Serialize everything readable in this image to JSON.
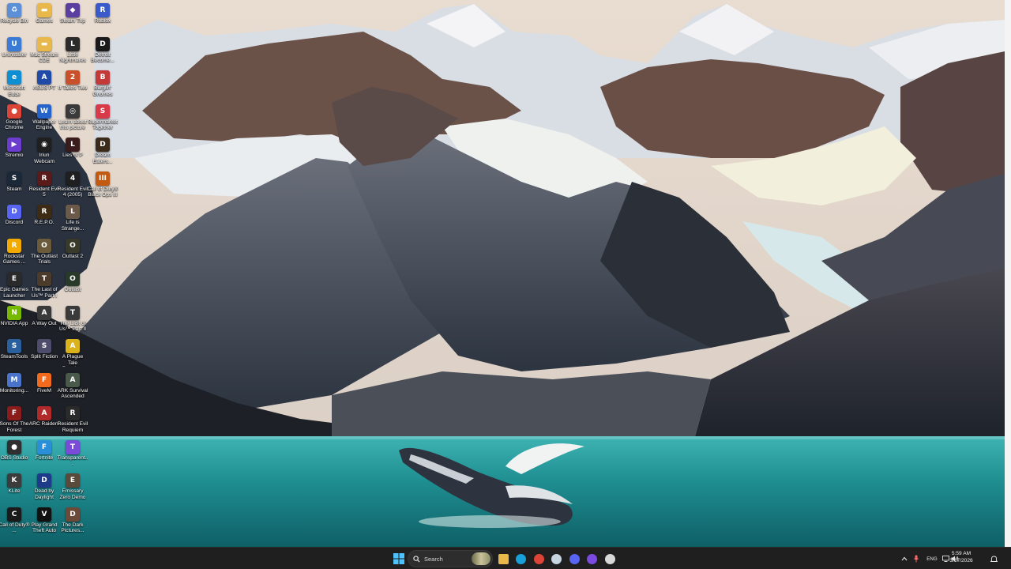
{
  "desktop": {
    "icons": [
      {
        "label": "Recycle Bin",
        "icon": "recycle-bin-icon",
        "color": "#5b8fd8",
        "glyph": "♻"
      },
      {
        "label": "Uninstaller",
        "icon": "uninstaller-icon",
        "color": "#3a7bd5",
        "glyph": "U"
      },
      {
        "label": "Microsoft Edge",
        "icon": "edge-icon",
        "color": "#0f8fd1",
        "glyph": "e"
      },
      {
        "label": "Google Chrome",
        "icon": "chrome-icon",
        "color": "#db4437",
        "glyph": "●"
      },
      {
        "label": "Stremio",
        "icon": "stremio-icon",
        "color": "#6c3ccf",
        "glyph": "▶"
      },
      {
        "label": "Steam",
        "icon": "steam-icon",
        "color": "#1b2838",
        "glyph": "S"
      },
      {
        "label": "Discord",
        "icon": "discord-icon",
        "color": "#5865f2",
        "glyph": "D"
      },
      {
        "label": "Rockstar Games ...",
        "icon": "rockstar-icon",
        "color": "#f2a900",
        "glyph": "R"
      },
      {
        "label": "Epic Games Launcher",
        "icon": "epic-games-icon",
        "color": "#2a2a2a",
        "glyph": "E"
      },
      {
        "label": "NVIDIA App",
        "icon": "nvidia-icon",
        "color": "#76b900",
        "glyph": "N"
      },
      {
        "label": "SteamTools",
        "icon": "steamtools-icon",
        "color": "#2a5f9e",
        "glyph": "S"
      },
      {
        "label": "Monitoring...",
        "icon": "monitoring-icon",
        "color": "#4a74c9",
        "glyph": "M"
      },
      {
        "label": "Sons Of The Forest",
        "icon": "sons-forest-icon",
        "color": "#8a1c1c",
        "glyph": "F"
      },
      {
        "label": "OBS Studio",
        "icon": "obs-icon",
        "color": "#302e31",
        "glyph": "●"
      },
      {
        "label": "KLite",
        "icon": "klite-icon",
        "color": "#3c3c3c",
        "glyph": "K"
      },
      {
        "label": "Call of Duty® ...",
        "icon": "cod-icon",
        "color": "#1a1a1a",
        "glyph": "C"
      },
      {
        "label": "Games",
        "icon": "folder-icon",
        "color": "#e8b94a",
        "glyph": "▬"
      },
      {
        "label": "Mac Stream CDE",
        "icon": "folder-icon-2",
        "color": "#e8b94a",
        "glyph": "▬"
      },
      {
        "label": "ASUS PT",
        "icon": "asus-icon",
        "color": "#1f4aa8",
        "glyph": "A"
      },
      {
        "label": "Wallpaper Engine",
        "icon": "wallpaper-engine-icon",
        "color": "#2463c9",
        "glyph": "W"
      },
      {
        "label": "Iriun Webcam",
        "icon": "webcam-icon",
        "color": "#1f1f1f",
        "glyph": "◉"
      },
      {
        "label": "Resident Evil 5",
        "icon": "re5-icon",
        "color": "#5a1a1a",
        "glyph": "R"
      },
      {
        "label": "R.E.P.O.",
        "icon": "repo-icon",
        "color": "#3d2b14",
        "glyph": "R"
      },
      {
        "label": "The Outlast Trials",
        "icon": "outlast-trials-icon",
        "color": "#6b5b3a",
        "glyph": "O"
      },
      {
        "label": "The Last of Us™ Part I",
        "icon": "tlou-icon",
        "color": "#4a3b2a",
        "glyph": "T"
      },
      {
        "label": "A Way Out",
        "icon": "a-way-out-icon",
        "color": "#3a3a3a",
        "glyph": "A"
      },
      {
        "label": "Split Fiction",
        "icon": "split-fiction-icon",
        "color": "#4d4d6b",
        "glyph": "S"
      },
      {
        "label": "FiveM",
        "icon": "fivem-icon",
        "color": "#f26b1d",
        "glyph": "F"
      },
      {
        "label": "ARC Raiders",
        "icon": "arc-raiders-icon",
        "color": "#b02a2a",
        "glyph": "A"
      },
      {
        "label": "Fortnite",
        "icon": "fortnite-icon",
        "color": "#2a8fd8",
        "glyph": "F"
      },
      {
        "label": "Dead by Daylight",
        "icon": "dbd-icon",
        "color": "#1e3a8a",
        "glyph": "D"
      },
      {
        "label": "Play Grand Theft Auto",
        "icon": "gta-icon",
        "color": "#111111",
        "glyph": "V"
      },
      {
        "label": "Steam Trip",
        "icon": "steam-trip-icon",
        "color": "#5a3fa0",
        "glyph": "◆"
      },
      {
        "label": "Little Nightmares",
        "icon": "little-nightmares-icon",
        "color": "#2b2b2b",
        "glyph": "L"
      },
      {
        "label": "It Takes Two",
        "icon": "it-takes-two-icon",
        "color": "#c8502a",
        "glyph": "2"
      },
      {
        "label": "Learn about this picture",
        "icon": "learn-picture-icon",
        "color": "#3a3a3a",
        "glyph": "◎"
      },
      {
        "label": "Lies of P",
        "icon": "lies-of-p-icon",
        "color": "#3b1c1c",
        "glyph": "L"
      },
      {
        "label": "Resident Evil 4 (2005)",
        "icon": "re4-icon",
        "color": "#1f1f1f",
        "glyph": "4"
      },
      {
        "label": "Life is Strange...",
        "icon": "life-is-strange-icon",
        "color": "#6b5a4a",
        "glyph": "L"
      },
      {
        "label": "Outlast 2",
        "icon": "outlast2-icon",
        "color": "#3a3a2a",
        "glyph": "O"
      },
      {
        "label": "Outlast",
        "icon": "outlast-icon",
        "color": "#2a3a2a",
        "glyph": "O"
      },
      {
        "label": "The Last of Us™ Part II",
        "icon": "tlou2-icon",
        "color": "#3a3a3a",
        "glyph": "T"
      },
      {
        "label": "A Plague Tale Requiem",
        "icon": "plague-tale-icon",
        "color": "#d9b21c",
        "glyph": "A"
      },
      {
        "label": "ARK Survival Ascended",
        "icon": "ark-icon",
        "color": "#4a5a4a",
        "glyph": "A"
      },
      {
        "label": "Resident Evil Requiem",
        "icon": "re-requiem-icon",
        "color": "#2a2a2a",
        "glyph": "R"
      },
      {
        "label": "Transparent...",
        "icon": "transparent-icon",
        "color": "#7a4ad8",
        "glyph": "T"
      },
      {
        "label": "Emissary Zero Demo",
        "icon": "emissary-icon",
        "color": "#5a4a3a",
        "glyph": "E"
      },
      {
        "label": "The Dark Pictures...",
        "icon": "dark-pictures-icon",
        "color": "#6b4a3a",
        "glyph": "D"
      },
      {
        "label": "Roblox",
        "icon": "roblox-icon",
        "color": "#3a5ac9",
        "glyph": "R"
      },
      {
        "label": "Detroit Become...",
        "icon": "detroit-icon",
        "color": "#1a1a1a",
        "glyph": "D"
      },
      {
        "label": "Burglin' Gnomes",
        "icon": "burglin-gnomes-icon",
        "color": "#c23a3a",
        "glyph": "B"
      },
      {
        "label": "Supermarket Together",
        "icon": "supermarket-icon",
        "color": "#d93a4a",
        "glyph": "S"
      },
      {
        "label": "Dream Eaters...",
        "icon": "dream-icon",
        "color": "#3a2a1a",
        "glyph": "D"
      },
      {
        "label": "Call of Duty® Black Ops III",
        "icon": "bo3-icon",
        "color": "#c25a14",
        "glyph": "III"
      }
    ]
  },
  "taskbar": {
    "search_placeholder": "Search",
    "pinned": [
      {
        "name": "taskbar-file-explorer",
        "icon": "folder-icon",
        "color": "#e8b94a"
      },
      {
        "name": "taskbar-edge",
        "icon": "edge-icon",
        "color": "#18a0d8"
      },
      {
        "name": "taskbar-chrome",
        "icon": "chrome-icon",
        "color": "#db4437"
      },
      {
        "name": "taskbar-steam",
        "icon": "steam-icon",
        "color": "#c7d5e0"
      },
      {
        "name": "taskbar-discord",
        "icon": "discord-icon",
        "color": "#5865f2"
      },
      {
        "name": "taskbar-stremio",
        "icon": "stremio-icon",
        "color": "#7b4ae0"
      },
      {
        "name": "taskbar-obs",
        "icon": "obs-icon",
        "color": "#d8d8d8"
      }
    ],
    "tray": {
      "language": "ENG",
      "time": "5:59 AM",
      "date": "3/17/2026"
    }
  }
}
